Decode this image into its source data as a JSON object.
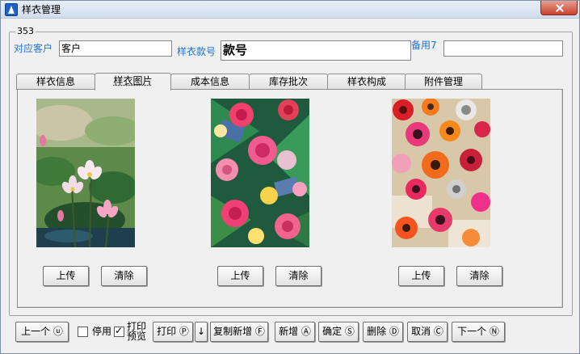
{
  "window": {
    "title": "样衣管理"
  },
  "group": {
    "label": "353"
  },
  "fields": {
    "customer_label": "对应客户",
    "customer_value": "客户",
    "style_no_label": "样衣款号",
    "style_no_value": "款号",
    "note7_label": "备用7",
    "note7_value": ""
  },
  "tabs": [
    "样衣信息",
    "样衣图片",
    "成本信息",
    "库存批次",
    "样衣构成",
    "附件管理"
  ],
  "active_tab": "样衣图片",
  "images": [
    {
      "name": "lotus-flower-painting",
      "upload": "上传",
      "clear": "清除"
    },
    {
      "name": "rose-dahlia-print",
      "upload": "上传",
      "clear": "清除"
    },
    {
      "name": "gerbera-rose-print",
      "upload": "上传",
      "clear": "清除"
    }
  ],
  "footer": {
    "prev": "上一个 ⓤ",
    "disable_label": "停用",
    "disable_checked": false,
    "print_preview_label_1": "打印",
    "print_preview_label_2": "预览",
    "print_preview_checked": true,
    "print": "打印 Ⓟ",
    "print_arrow": "↓",
    "copy_new": "复制新增 Ⓕ",
    "add": "新增 Ⓐ",
    "confirm": "确定 Ⓢ",
    "delete": "删除 Ⓓ",
    "cancel": "取消 Ⓒ",
    "next": "下一个 Ⓝ"
  },
  "colors": {
    "label_blue": "#2074d8",
    "window_bg": "#f0f0f0"
  }
}
